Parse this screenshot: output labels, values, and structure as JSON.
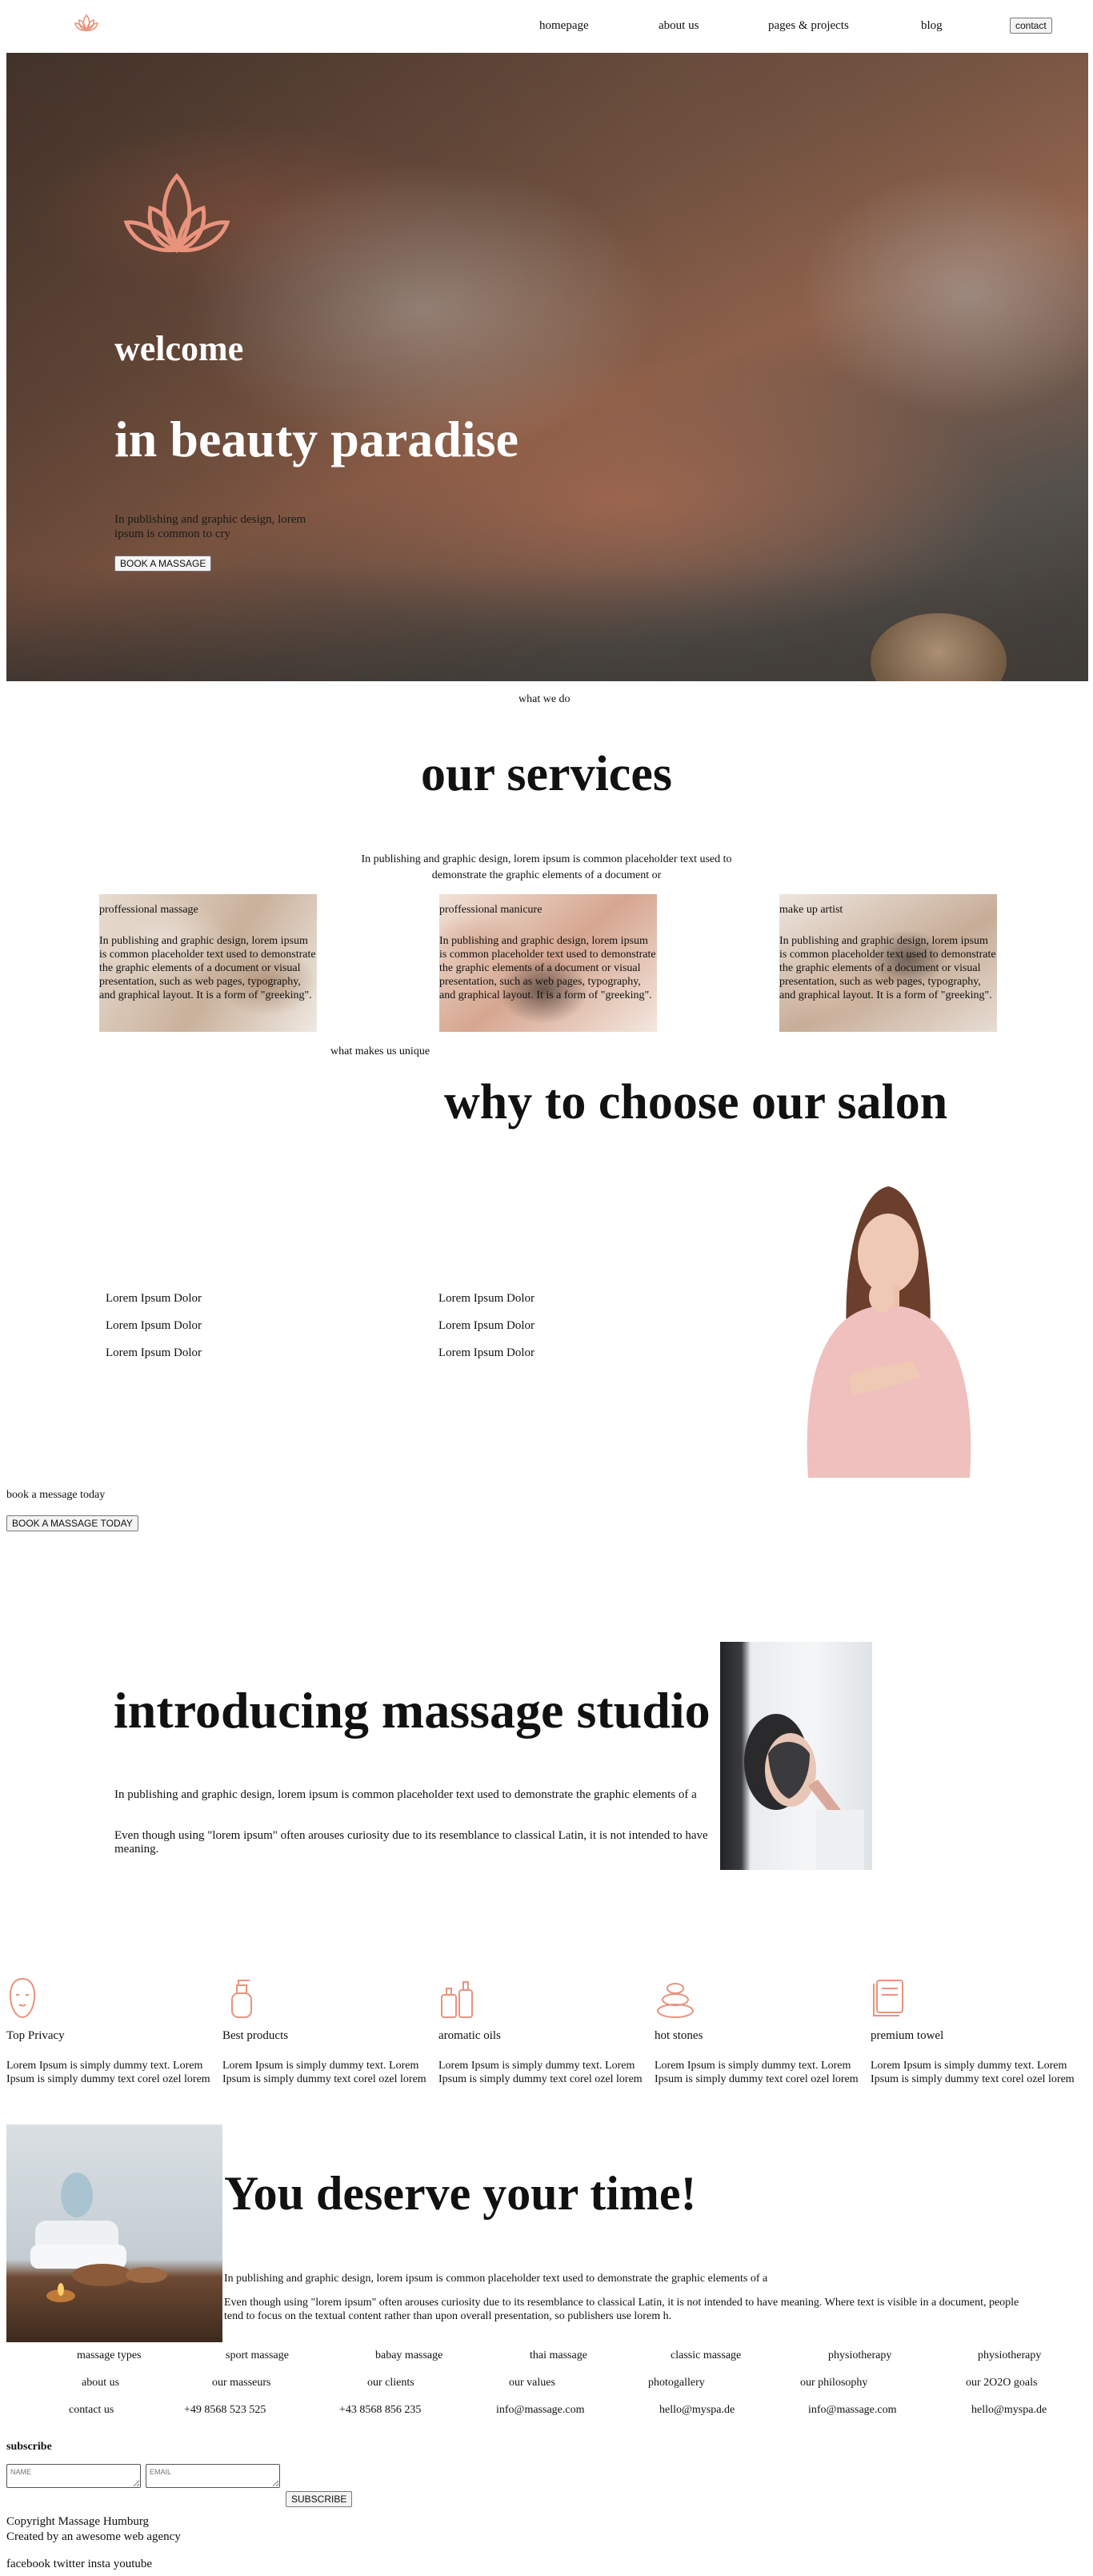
{
  "nav": {
    "items": [
      "homepage",
      "about us",
      "pages & projects",
      "blog"
    ],
    "contact": "contact"
  },
  "hero": {
    "welcome": "welcome",
    "title": "in beauty paradise",
    "text": "In publishing and graphic design, lorem ipsum is common to cry",
    "button": "BOOK A MASSAGE"
  },
  "services": {
    "kicker": "what we do",
    "title": "our services",
    "intro": "In publishing and graphic design, lorem ipsum is common placeholder text used to demonstrate the graphic elements of a document or",
    "cards": [
      {
        "title": "proffessional massage",
        "text": "In publishing and graphic design, lorem ipsum is common placeholder text used to demonstrate the graphic elements of a document or visual presentation, such as web pages, typography, and graphical layout. It is a form of \"greeking\"."
      },
      {
        "title": "proffessional manicure",
        "text": "In publishing and graphic design, lorem ipsum is common placeholder text used to demonstrate the graphic elements of a document or visual presentation, such as web pages, typography, and graphical layout. It is a form of \"greeking\"."
      },
      {
        "title": "make up artist",
        "text": "In publishing and graphic design, lorem ipsum is common placeholder text used to demonstrate the graphic elements of a document or visual presentation, such as web pages, typography, and graphical layout. It is a form of \"greeking\"."
      }
    ]
  },
  "why": {
    "kicker": "what makes us unique",
    "title": "why to choose our salon",
    "features_left": [
      "Lorem Ipsum Dolor",
      "Lorem Ipsum Dolor",
      "Lorem Ipsum Dolor"
    ],
    "features_right": [
      "Lorem Ipsum Dolor",
      "Lorem Ipsum Dolor",
      "Lorem Ipsum Dolor"
    ]
  },
  "book": {
    "label": "book a message today",
    "button": "BOOK A MASSAGE TODAY"
  },
  "studio": {
    "title": "introducing massage studio",
    "p1": "In publishing and graphic design, lorem ipsum is common placeholder text used to demonstrate the graphic elements of a",
    "p2": "Even though using \"lorem ipsum\" often arouses curiosity due to its resemblance to classical Latin, it is not intended to have meaning."
  },
  "perks": [
    {
      "icon": "face-mask-icon",
      "title": "Top Privacy",
      "text": "Lorem Ipsum is simply dummy text. Lorem Ipsum is simply dummy text corel ozel lorem"
    },
    {
      "icon": "lotion-bottle-icon",
      "title": "Best products",
      "text": "Lorem Ipsum is simply dummy text. Lorem Ipsum is simply dummy text corel ozel lorem"
    },
    {
      "icon": "oil-bottles-icon",
      "title": "aromatic oils",
      "text": "Lorem Ipsum is simply dummy text. Lorem Ipsum is simply dummy text corel ozel lorem"
    },
    {
      "icon": "hot-stones-icon",
      "title": "hot stones",
      "text": "Lorem Ipsum is simply dummy text. Lorem Ipsum is simply dummy text corel ozel lorem"
    },
    {
      "icon": "towel-icon",
      "title": "premium towel",
      "text": "Lorem Ipsum is simply dummy text. Lorem Ipsum is simply dummy text corel ozel lorem"
    }
  ],
  "deserve": {
    "title": "You deserve your time!",
    "p1": "In publishing and graphic design, lorem ipsum is common placeholder text used to demonstrate the graphic elements of a",
    "p2": "Even though using \"lorem ipsum\" often arouses curiosity due to its resemblance to classical Latin, it is not intended to have meaning. Where text is visible in a document, people tend to focus on the textual content rather than upon overall presentation, so publishers use lorem h."
  },
  "footer": {
    "row1": [
      "massage types",
      "sport massage",
      "babay massage",
      "thai massage",
      "classic massage",
      "physiotherapy",
      "physiotherapy"
    ],
    "row2": [
      "about us",
      "our masseurs",
      "our clients",
      "our values",
      "photogallery",
      "our philosophy",
      "our 2O2O goals"
    ],
    "row3": [
      "contact us",
      "+49 8568 523 525",
      "+43 8568 856 235",
      "info@massage.com",
      "hello@myspa.de",
      "info@massage.com",
      "hello@myspa.de"
    ]
  },
  "subscribe": {
    "label": "subscribe",
    "name_placeholder": "NAME",
    "email_placeholder": "EMAIL",
    "button": "SUBSCRIBE"
  },
  "copyright": {
    "line1": "Copyright Massage Humburg",
    "line2": "Created by an awesome web agency"
  },
  "social": "facebook twitter insta youtube",
  "colors": {
    "accent": "#e9937d"
  }
}
